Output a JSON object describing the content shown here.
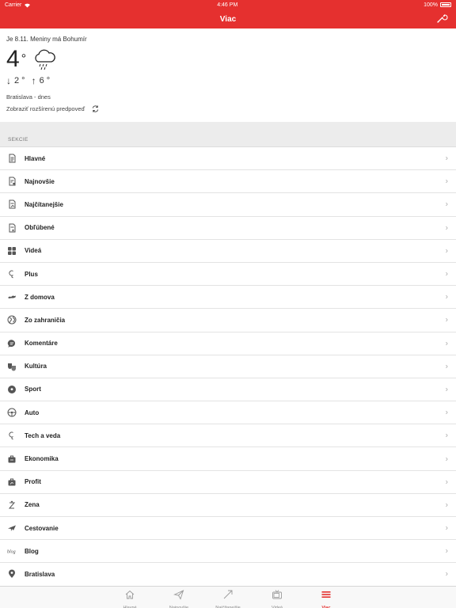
{
  "status": {
    "carrier": "Carrier",
    "time": "4:46 PM",
    "battery": "100%"
  },
  "nav": {
    "title": "Viac"
  },
  "weather": {
    "nameday": "Je 8.11. Meniny má Bohumír",
    "temp": "4",
    "degree": "°",
    "min": "2 °",
    "max": "6 °",
    "location": "Bratislava - dnes",
    "forecast_link": "Zobraziť rozšírenú predpoveď"
  },
  "sections": {
    "header": "SEKCIE",
    "items": [
      {
        "label": "Hlavné",
        "icon": "doc-icon"
      },
      {
        "label": "Najnovšie",
        "icon": "doc-new-icon"
      },
      {
        "label": "Najčítanejšie",
        "icon": "doc-trending-icon"
      },
      {
        "label": "Obľúbené",
        "icon": "doc-favorite-icon"
      },
      {
        "label": "Videá",
        "icon": "grid-icon"
      },
      {
        "label": "Plus",
        "icon": "plus-logo-icon"
      },
      {
        "label": "Z domova",
        "icon": "slovakia-map-icon"
      },
      {
        "label": "Zo zahraničia",
        "icon": "globe-icon"
      },
      {
        "label": "Komentáre",
        "icon": "comment-icon"
      },
      {
        "label": "Kultúra",
        "icon": "theater-masks-icon"
      },
      {
        "label": "Sport",
        "icon": "soccer-ball-icon"
      },
      {
        "label": "Auto",
        "icon": "steering-wheel-icon"
      },
      {
        "label": "Tech a veda",
        "icon": "tech-logo-icon"
      },
      {
        "label": "Ekonomika",
        "icon": "briefcase-icon"
      },
      {
        "label": "Profit",
        "icon": "profit-briefcase-icon"
      },
      {
        "label": "Zena",
        "icon": "zena-logo-icon"
      },
      {
        "label": "Cestovanie",
        "icon": "airplane-icon"
      },
      {
        "label": "Blog",
        "icon": "blog-script-icon"
      },
      {
        "label": "Bratislava",
        "icon": "location-pin-icon"
      }
    ]
  },
  "tabs": [
    {
      "label": "Hlavné",
      "icon": "home-icon",
      "active": false
    },
    {
      "label": "Najnovšie",
      "icon": "paper-plane-icon",
      "active": false
    },
    {
      "label": "Najčítanejšie",
      "icon": "trending-arrow-icon",
      "active": false
    },
    {
      "label": "Videá",
      "icon": "tv-icon",
      "active": false
    },
    {
      "label": "Viac",
      "icon": "menu-icon",
      "active": true
    }
  ],
  "colors": {
    "accent": "#e5302f"
  }
}
